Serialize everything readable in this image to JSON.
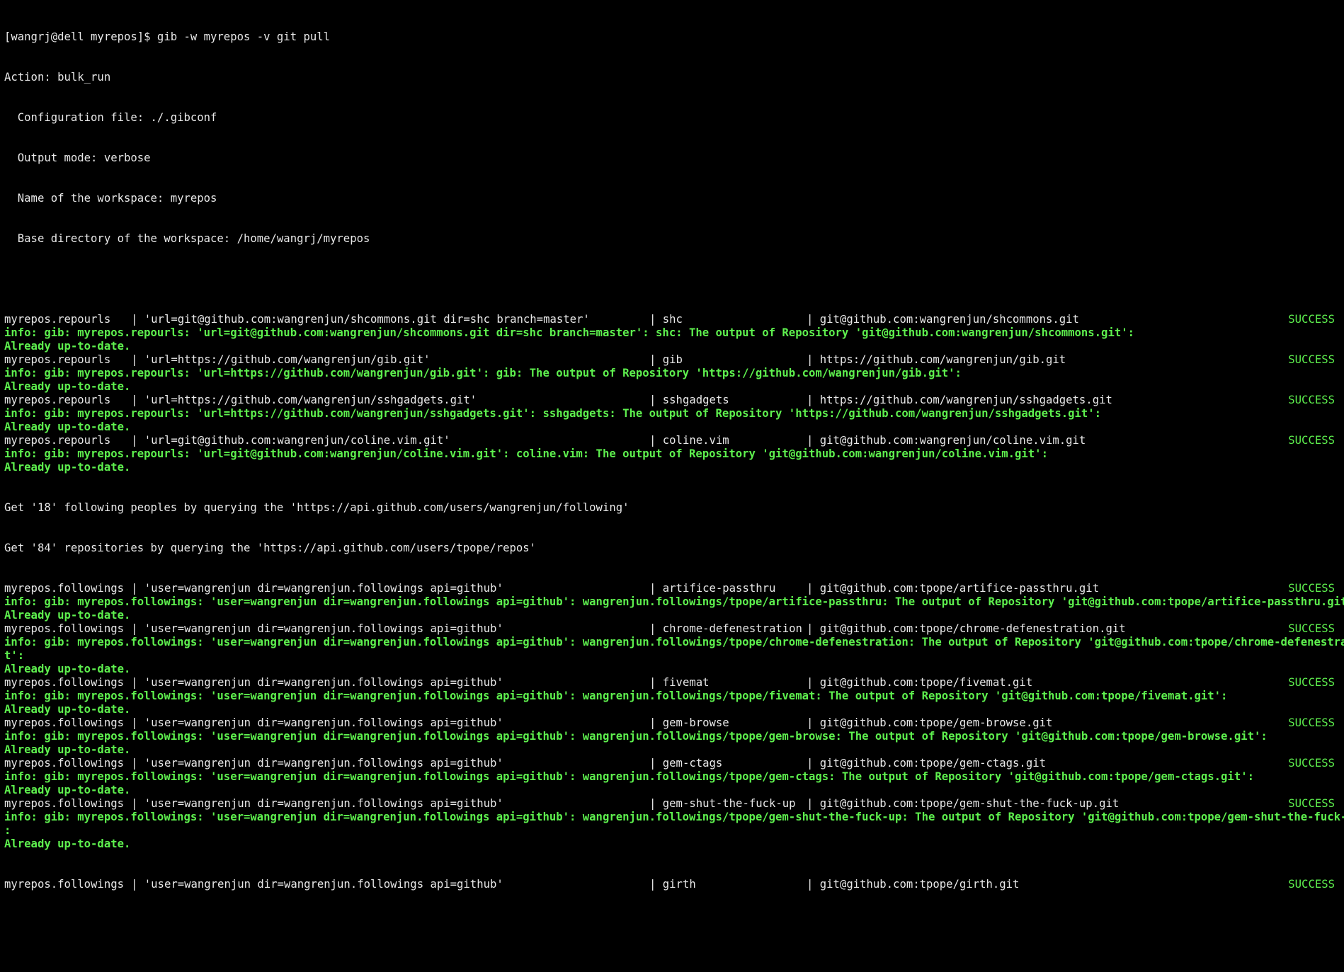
{
  "terminal": {
    "prompt": "[wangrj@dell myrepos]$ gib -w myrepos -v git pull",
    "header": [
      "Action: bulk_run",
      "  Configuration file: ./.gibconf",
      "  Output mode: verbose",
      "  Name of the workspace: myrepos",
      "  Base directory of the workspace: /home/wangrj/myrepos"
    ],
    "repourls": [
      {
        "group": "myrepos.repourls",
        "spec": "'url=git@github.com:wangrenjun/shcommons.git dir=shc branch=master'",
        "name": "shc",
        "url": "git@github.com:wangrenjun/shcommons.git",
        "status": "SUCCESS",
        "info": "info: gib: myrepos.repourls: 'url=git@github.com:wangrenjun/shcommons.git dir=shc branch=master': shc: The output of Repository 'git@github.com:wangrenjun/shcommons.git':",
        "result": "Already up-to-date."
      },
      {
        "group": "myrepos.repourls",
        "spec": "'url=https://github.com/wangrenjun/gib.git'",
        "name": "gib",
        "url": "https://github.com/wangrenjun/gib.git",
        "status": "SUCCESS",
        "info": "info: gib: myrepos.repourls: 'url=https://github.com/wangrenjun/gib.git': gib: The output of Repository 'https://github.com/wangrenjun/gib.git':",
        "result": "Already up-to-date."
      },
      {
        "group": "myrepos.repourls",
        "spec": "'url=https://github.com/wangrenjun/sshgadgets.git'",
        "name": "sshgadgets",
        "url": "https://github.com/wangrenjun/sshgadgets.git",
        "status": "SUCCESS",
        "info": "info: gib: myrepos.repourls: 'url=https://github.com/wangrenjun/sshgadgets.git': sshgadgets: The output of Repository 'https://github.com/wangrenjun/sshgadgets.git':",
        "result": "Already up-to-date."
      },
      {
        "group": "myrepos.repourls",
        "spec": "'url=git@github.com:wangrenjun/coline.vim.git'",
        "name": "coline.vim",
        "url": "git@github.com:wangrenjun/coline.vim.git",
        "status": "SUCCESS",
        "info": "info: gib: myrepos.repourls: 'url=git@github.com:wangrenjun/coline.vim.git': coline.vim: The output of Repository 'git@github.com:wangrenjun/coline.vim.git':",
        "result": "Already up-to-date."
      }
    ],
    "query_lines": [
      "Get '18' following peoples by querying the 'https://api.github.com/users/wangrenjun/following'",
      "Get '84' repositories by querying the 'https://api.github.com/users/tpope/repos'"
    ],
    "followings": [
      {
        "group": "myrepos.followings",
        "spec": "'user=wangrenjun dir=wangrenjun.followings api=github'",
        "name": "artifice-passthru",
        "url": "git@github.com:tpope/artifice-passthru.git",
        "status": "SUCCESS",
        "info": "info: gib: myrepos.followings: 'user=wangrenjun dir=wangrenjun.followings api=github': wangrenjun.followings/tpope/artifice-passthru: The output of Repository 'git@github.com:tpope/artifice-passthru.git':",
        "info_cont": "",
        "result": "Already up-to-date."
      },
      {
        "group": "myrepos.followings",
        "spec": "'user=wangrenjun dir=wangrenjun.followings api=github'",
        "name": "chrome-defenestration",
        "url": "git@github.com:tpope/chrome-defenestration.git",
        "status": "SUCCESS",
        "info": "info: gib: myrepos.followings: 'user=wangrenjun dir=wangrenjun.followings api=github': wangrenjun.followings/tpope/chrome-defenestration: The output of Repository 'git@github.com:tpope/chrome-defenestration.gi",
        "info_cont": "t':",
        "result": "Already up-to-date."
      },
      {
        "group": "myrepos.followings",
        "spec": "'user=wangrenjun dir=wangrenjun.followings api=github'",
        "name": "fivemat",
        "url": "git@github.com:tpope/fivemat.git",
        "status": "SUCCESS",
        "info": "info: gib: myrepos.followings: 'user=wangrenjun dir=wangrenjun.followings api=github': wangrenjun.followings/tpope/fivemat: The output of Repository 'git@github.com:tpope/fivemat.git':",
        "info_cont": "",
        "result": "Already up-to-date."
      },
      {
        "group": "myrepos.followings",
        "spec": "'user=wangrenjun dir=wangrenjun.followings api=github'",
        "name": "gem-browse",
        "url": "git@github.com:tpope/gem-browse.git",
        "status": "SUCCESS",
        "info": "info: gib: myrepos.followings: 'user=wangrenjun dir=wangrenjun.followings api=github': wangrenjun.followings/tpope/gem-browse: The output of Repository 'git@github.com:tpope/gem-browse.git':",
        "info_cont": "",
        "result": "Already up-to-date."
      },
      {
        "group": "myrepos.followings",
        "spec": "'user=wangrenjun dir=wangrenjun.followings api=github'",
        "name": "gem-ctags",
        "url": "git@github.com:tpope/gem-ctags.git",
        "status": "SUCCESS",
        "info": "info: gib: myrepos.followings: 'user=wangrenjun dir=wangrenjun.followings api=github': wangrenjun.followings/tpope/gem-ctags: The output of Repository 'git@github.com:tpope/gem-ctags.git':",
        "info_cont": "",
        "result": "Already up-to-date."
      },
      {
        "group": "myrepos.followings",
        "spec": "'user=wangrenjun dir=wangrenjun.followings api=github'",
        "name": "gem-shut-the-fuck-up",
        "url": "git@github.com:tpope/gem-shut-the-fuck-up.git",
        "status": "SUCCESS",
        "info": "info: gib: myrepos.followings: 'user=wangrenjun dir=wangrenjun.followings api=github': wangrenjun.followings/tpope/gem-shut-the-fuck-up: The output of Repository 'git@github.com:tpope/gem-shut-the-fuck-up.git'",
        "info_cont": ":",
        "result": "Already up-to-date."
      }
    ],
    "last_row": {
      "group": "myrepos.followings",
      "spec": "'user=wangrenjun dir=wangrenjun.followings api=github'",
      "name": "girth",
      "url": "git@github.com:tpope/girth.git",
      "status": "SUCCESS"
    },
    "separator": "|",
    "colors": {
      "background": "#000000",
      "text": "#e8e8e8",
      "success_green": "#5ef04e"
    }
  }
}
